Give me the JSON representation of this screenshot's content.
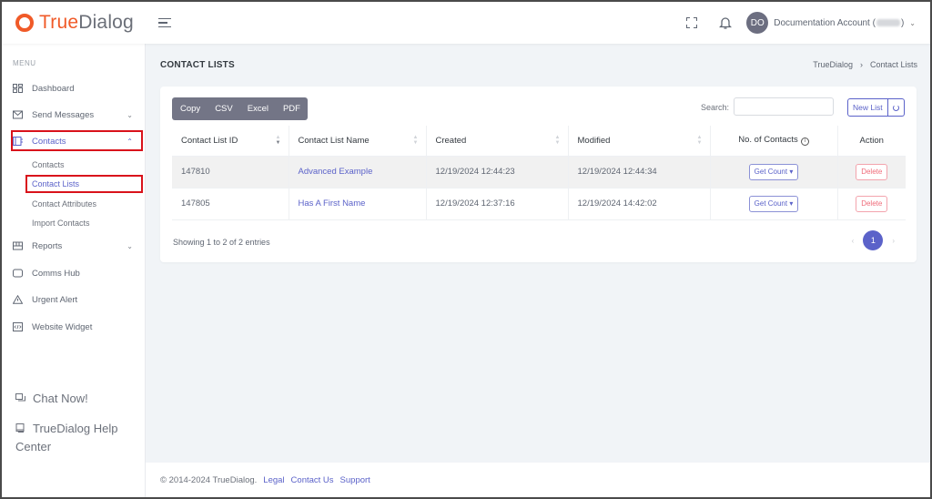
{
  "brand": {
    "name_part1": "True",
    "name_part2": "Dialog",
    "color": "#f05a28"
  },
  "header": {
    "avatar_initials": "DO",
    "account_label": "Documentation Account (",
    "account_suffix": ")",
    "icons": [
      "hamburger-icon",
      "fullscreen-icon",
      "bell-icon",
      "chevron-down-icon"
    ]
  },
  "sidebar": {
    "menu_label": "MENU",
    "items": [
      {
        "label": "Dashboard",
        "icon": "dashboard-icon",
        "chevron": ""
      },
      {
        "label": "Send Messages",
        "icon": "envelope-icon",
        "chevron": "⌄"
      },
      {
        "label": "Contacts",
        "icon": "contacts-icon",
        "chevron": "⌃",
        "active": true
      },
      {
        "label": "Reports",
        "icon": "reports-icon",
        "chevron": "⌄"
      },
      {
        "label": "Comms Hub",
        "icon": "chat-bubble-icon",
        "chevron": ""
      },
      {
        "label": "Urgent Alert",
        "icon": "warning-icon",
        "chevron": ""
      },
      {
        "label": "Website Widget",
        "icon": "code-icon",
        "chevron": ""
      }
    ],
    "contacts_sub": [
      {
        "label": "Contacts"
      },
      {
        "label": "Contact Lists",
        "active": true
      },
      {
        "label": "Contact Attributes"
      },
      {
        "label": "Import Contacts"
      }
    ],
    "bottom": {
      "chat": "Chat Now!",
      "help": "TrueDialog Help Center"
    }
  },
  "page": {
    "title": "CONTACT LISTS",
    "breadcrumb": [
      "TrueDialog",
      "Contact Lists"
    ],
    "breadcrumb_sep": "›"
  },
  "toolbar": {
    "export_buttons": [
      "Copy",
      "CSV",
      "Excel",
      "PDF"
    ],
    "search_label": "Search:",
    "search_value": "",
    "new_list_label": "New List"
  },
  "table": {
    "columns": [
      "Contact List ID",
      "Contact List Name",
      "Created",
      "Modified",
      "No. of Contacts",
      "Action"
    ],
    "rows": [
      {
        "id": "147810",
        "name": "Advanced Example",
        "created": "12/19/2024 12:44:23",
        "modified": "12/19/2024 12:44:34",
        "count_button": "Get Count ▾",
        "action": "Delete"
      },
      {
        "id": "147805",
        "name": "Has A First Name",
        "created": "12/19/2024 12:37:16",
        "modified": "12/19/2024 14:42:02",
        "count_button": "Get Count ▾",
        "action": "Delete"
      }
    ],
    "info_text": "Showing 1 to 2 of 2 entries",
    "pagination": {
      "prev": "‹",
      "current": "1",
      "next": "›"
    }
  },
  "footer": {
    "copyright": "© 2014-2024 TrueDialog.",
    "links": [
      "Legal",
      "Contact Us",
      "Support"
    ]
  }
}
